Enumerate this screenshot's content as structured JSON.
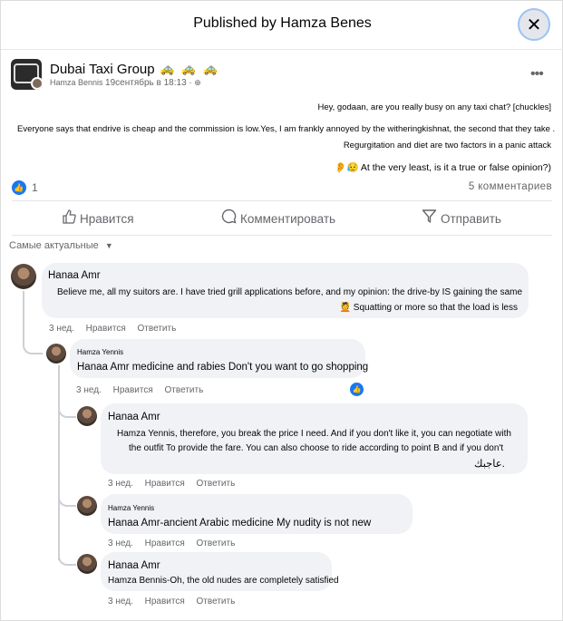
{
  "modal": {
    "title": "Published by Hamza Benes",
    "close_glyph": "✕"
  },
  "post": {
    "group_name": "Dubai Taxi Group",
    "group_emoji": "🚕 🚕 🚕",
    "author": "Hamza Bennis",
    "date": "19сентябрь в 18:13 ·",
    "privacy_icon": "globe-icon",
    "more_glyph": "•••",
    "lines": [
      "Hey, godaan, are you really busy on any taxi chat? [chuckles]",
      "Everyone says that endrive is cheap and the commission is low.Yes, I am frankly annoyed by the witheringkishnat, the second that they take .",
      "Regurgitation and diet are two factors in a panic attack",
      "👂😥 At the very least, is it a true or false opinion?)"
    ],
    "like_count": "1",
    "comments_count": "5 комментариев"
  },
  "actions": {
    "like": "Нравится",
    "comment": "Комментировать",
    "share": "Отправить"
  },
  "sort_label": "Самые актуальные",
  "comments": [
    {
      "name": "Hanaa Amr",
      "lines": [
        "Believe me, all my suitors are. I have tried grill applications before, and my opinion: the drive-by IS gaining the same",
        "💆 Squatting or more so that the load is less"
      ],
      "time": "3 нед.",
      "like": "Нравится",
      "reply": "Ответить"
    },
    {
      "name": "Hamza Yennis",
      "lines": [
        "Hanaa Amr medicine and rabies Don't you want to go shopping"
      ],
      "time": "3 нед.",
      "like": "Нравится",
      "reply": "Ответить",
      "reactions": "1"
    },
    {
      "name": "Hanaa Amr",
      "lines": [
        "Hamza Yennis, therefore, you break the price I need. And if you don't like it, you can negotiate with",
        "the outfit To provide the fare. You can also choose to ride according to point B and if you don't",
        "عاجبك."
      ],
      "time": "3 нед.",
      "like": "Нравится",
      "reply": "Ответить"
    },
    {
      "name": "Hamza Yennis",
      "lines": [
        "Hanaa Amr-ancient Arabic medicine My nudity is not new"
      ],
      "time": "3 нед.",
      "like": "Нравится",
      "reply": "Ответить"
    },
    {
      "name": "Hanaa Amr",
      "lines": [
        "Hamza Bennis-Oh, the old nudes are completely satisfied"
      ],
      "time": "3 нед.",
      "like": "Нравится",
      "reply": "Ответить"
    }
  ]
}
